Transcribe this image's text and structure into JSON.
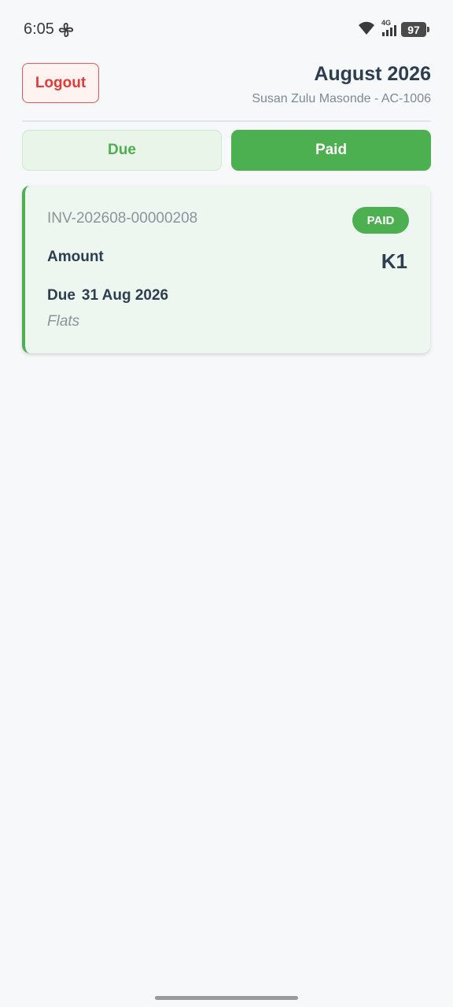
{
  "status_bar": {
    "time": "6:05",
    "network": "4G",
    "battery": "97"
  },
  "header": {
    "logout_label": "Logout",
    "month": "August 2026",
    "account": "Susan Zulu Masonde - AC-1006"
  },
  "tabs": [
    {
      "label": "Due",
      "active": false
    },
    {
      "label": "Paid",
      "active": true
    }
  ],
  "invoices": [
    {
      "number": "INV-202608-00000208",
      "status": "PAID",
      "amount_label": "Amount",
      "amount": "K1",
      "due_label": "Due",
      "due_date": "31 Aug 2026",
      "category": "Flats"
    }
  ],
  "colors": {
    "accent": "#4caf50",
    "danger": "#e53935",
    "text": "#2c3e50",
    "muted": "#8a949c"
  }
}
